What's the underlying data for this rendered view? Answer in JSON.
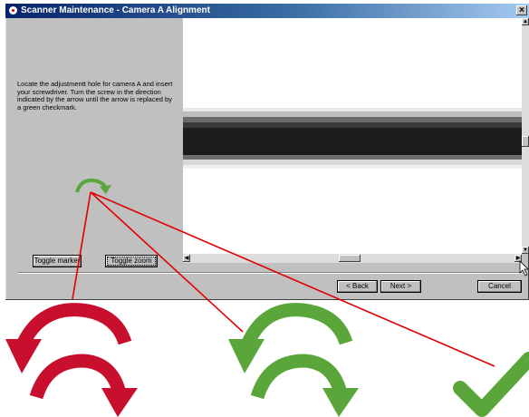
{
  "window": {
    "title": "Scanner Maintenance - Camera A Alignment",
    "close_label": "×"
  },
  "instructions": "Locate the adjustmentt hole for camera A and insert your screwdriver. Turn the screw in the direction indicated by the arrow until the arrow is replaced by a green checkmark.",
  "buttons": {
    "toggle_marker": "Toggle marker",
    "toggle_zoom": "Toggle zoom",
    "back": "< Back",
    "next": "Next >",
    "cancel": "Cancel"
  },
  "colors": {
    "titlebar_start": "#08246b",
    "dialog_bg": "#c0c0c0",
    "arrow_green": "#5aa63a",
    "arrow_red": "#c8102e",
    "callout_line": "#e00000"
  },
  "legend_icons": [
    "rotate-counterclockwise-red-icon",
    "rotate-clockwise-red-icon",
    "rotate-counterclockwise-green-icon",
    "rotate-clockwise-green-icon",
    "checkmark-green-icon"
  ]
}
